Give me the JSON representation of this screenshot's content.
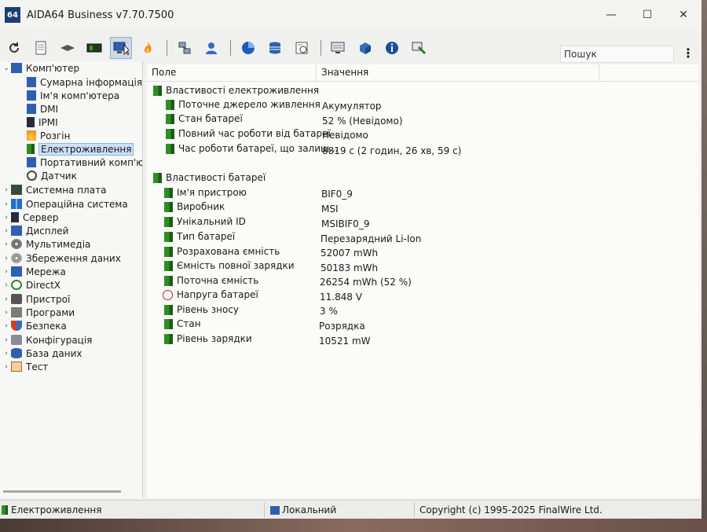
{
  "window": {
    "app_icon": "64",
    "title": "AIDA64 Business v7.70.7500",
    "controls": [
      "—",
      "☐",
      "✕"
    ]
  },
  "toolbar": {
    "search_placeholder": "Пошук",
    "icons": [
      "refresh-icon",
      "report-icon",
      "ram-icon",
      "motherboard-icon",
      "computer-icon",
      "flame-icon",
      "network-icon",
      "user-icon",
      "sysinfo-icon",
      "database-icon",
      "benchmark-icon",
      "monitor-icon",
      "directx-icon",
      "info-icon",
      "tools-icon"
    ]
  },
  "tree": {
    "items": [
      {
        "label": "Комп'ютер",
        "level": 0,
        "expanded": true
      },
      {
        "label": "Сумарна інформація",
        "level": 1
      },
      {
        "label": "Ім'я комп'ютера",
        "level": 1
      },
      {
        "label": "DMI",
        "level": 1
      },
      {
        "label": "IPMI",
        "level": 1
      },
      {
        "label": "Розгін",
        "level": 1
      },
      {
        "label": "Електроживлення",
        "level": 1,
        "selected": true
      },
      {
        "label": "Портативний комп'ютер",
        "level": 1
      },
      {
        "label": "Датчик",
        "level": 1
      },
      {
        "label": "Системна плата",
        "level": 0
      },
      {
        "label": "Операційна система",
        "level": 0
      },
      {
        "label": "Сервер",
        "level": 0
      },
      {
        "label": "Дисплей",
        "level": 0
      },
      {
        "label": "Мультимедіа",
        "level": 0
      },
      {
        "label": "Збереження даних",
        "level": 0
      },
      {
        "label": "Мережа",
        "level": 0
      },
      {
        "label": "DirectX",
        "level": 0
      },
      {
        "label": "Пристрої",
        "level": 0
      },
      {
        "label": "Програми",
        "level": 0
      },
      {
        "label": "Безпека",
        "level": 0
      },
      {
        "label": "Конфігурація",
        "level": 0
      },
      {
        "label": "База даних",
        "level": 0
      },
      {
        "label": "Тест",
        "level": 0
      }
    ]
  },
  "table": {
    "headers": {
      "field": "Поле",
      "value": "Значення"
    },
    "groups": [
      {
        "title": "Властивості електроживлення",
        "rows": [
          {
            "field": "Поточне джерело живлення",
            "value": "Акумулятор"
          },
          {
            "field": "Стан батареї",
            "value": "52 % (Невідомо)"
          },
          {
            "field": "Повний час роботи від батареї",
            "value": "Невідомо"
          },
          {
            "field": "Час роботи батареї, що залиш...",
            "value": "8819 с (2 годин, 26 хв, 59 с)"
          }
        ]
      },
      {
        "title": "Властивості батареї",
        "rows": [
          {
            "field": "Ім'я пристрою",
            "value": "BIF0_9"
          },
          {
            "field": "Виробник",
            "value": "MSI"
          },
          {
            "field": "Унікальний ID",
            "value": "MSIBIF0_9"
          },
          {
            "field": "Тип батареї",
            "value": "Перезарядний Li-Ion"
          },
          {
            "field": "Розрахована ємність",
            "value": "52007 mWh"
          },
          {
            "field": "Ємність повної зарядки",
            "value": "50183 mWh"
          },
          {
            "field": "Поточна ємність",
            "value": "26254 mWh  (52 %)"
          },
          {
            "field": "Напруга батареї",
            "value": "11.848 V"
          },
          {
            "field": "Рівень зносу",
            "value": "3 %"
          },
          {
            "field": "Стан",
            "value": "Розрядка"
          },
          {
            "field": "Рівень зарядки",
            "value": "10521 mW"
          }
        ]
      }
    ]
  },
  "statusbar": {
    "left": "Електроживлення",
    "middle": "Локальний",
    "right": "Copyright (c) 1995-2025 FinalWire Ltd."
  }
}
